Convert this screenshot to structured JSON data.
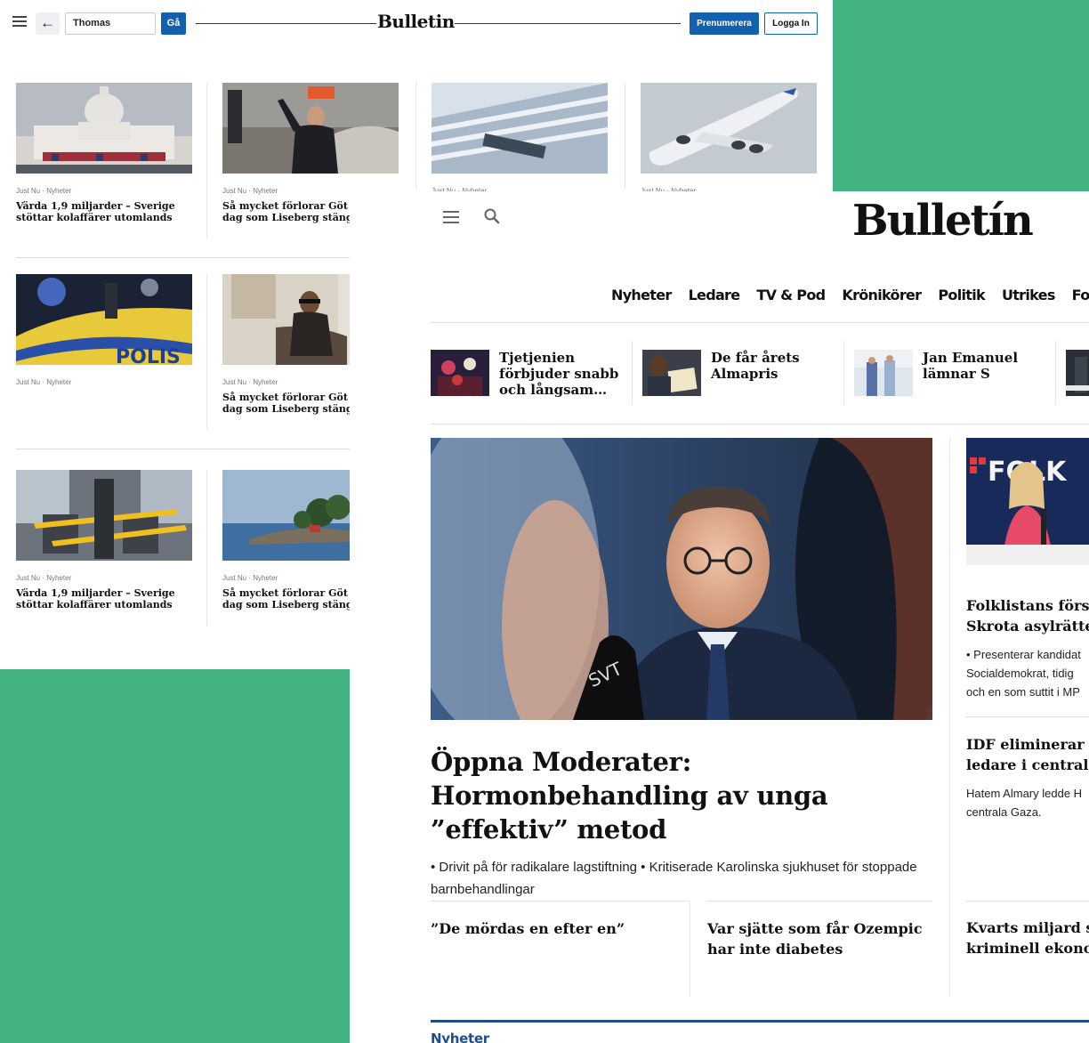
{
  "back_window": {
    "header": {
      "search_value": "Thomas",
      "go_label": "Gå",
      "logo": "Bulletin",
      "subscribe_label": "Prenumerera",
      "login_label": "Logga In"
    },
    "articles": [
      {
        "meta": "Just Nu · Nyheter",
        "title": "Värda 1,9 miljarder – Sverige stöttar kolaffärer utomlands",
        "image": "capitol-building"
      },
      {
        "meta": "Just Nu · Nyheter",
        "title": "Så mycket förlorar Göt varje dag som Liseberg stängt",
        "image": "man-waving-street"
      },
      {
        "meta": "Just Nu · Nyheter",
        "title": "",
        "image": "office-building"
      },
      {
        "meta": "Just Nu · Nyheter",
        "title": "",
        "image": "airbus-a380"
      },
      {
        "meta": "Just Nu · Nyheter",
        "title": "",
        "image": "police-car-night"
      },
      {
        "meta": "Just Nu · Nyheter",
        "title": "Så mycket förlorar Göt varje dag som Liseberg stängt",
        "image": "man-sitting-sofa"
      },
      {
        "meta": "Just Nu · Nyheter",
        "title": "Värda 1,9 miljarder – Sverige stöttar kolaffärer utomlands",
        "image": "bus-interior-taped"
      },
      {
        "meta": "Just Nu · Nyheter",
        "title": "Så mycket förlorar Göt varje dag som Liseberg stängt",
        "image": "archipelago-island"
      }
    ]
  },
  "front_window": {
    "logo": "Bulletín",
    "nav": [
      "Nyheter",
      "Ledare",
      "TV & Pod",
      "Krönikörer",
      "Politik",
      "Utrikes",
      "Fokus"
    ],
    "teasers": [
      {
        "title": "Tjetjenien förbjuder snabb och långsam…",
        "image": "tjetjenien-crowd"
      },
      {
        "title": "De får årets Almapris",
        "image": "reading-book"
      },
      {
        "title": "Jan Emanuel lämnar S",
        "image": "jan-emanuel-walking"
      }
    ],
    "hero": {
      "title": "Öppna Moderater: Hormonbehandling av unga ”effektiv” metod",
      "bullets": "• Drivit på för radikalare lagstiftning • Kritiserade Karolinska sjukhuset för stoppade barnbehandlingar",
      "image": "politician-press-interview"
    },
    "subheads": [
      "”De mördas en efter en”",
      "Var sjätte som får Ozempic har inte diabetes"
    ],
    "side": {
      "story1_title": [
        "Folklistans först",
        "Skrota asylrätte"
      ],
      "story1_text": [
        "• Presenterar kandidat",
        "Socialdemokrat, tidig",
        "och en som suttit i MP"
      ],
      "story2_title": [
        "IDF eliminerar",
        "ledare i centrala"
      ],
      "story2_text": [
        "Hatem Almary ledde H",
        "centrala Gaza."
      ],
      "story3_title": [
        "Kvarts miljard s",
        "kriminell ekono"
      ],
      "image": "folklistan-press-conference"
    },
    "section_label": "Nyheter"
  },
  "colors": {
    "accent_blue": "#1260b0",
    "background_green": "#43b47f",
    "section_blue": "#1f4e8c"
  }
}
